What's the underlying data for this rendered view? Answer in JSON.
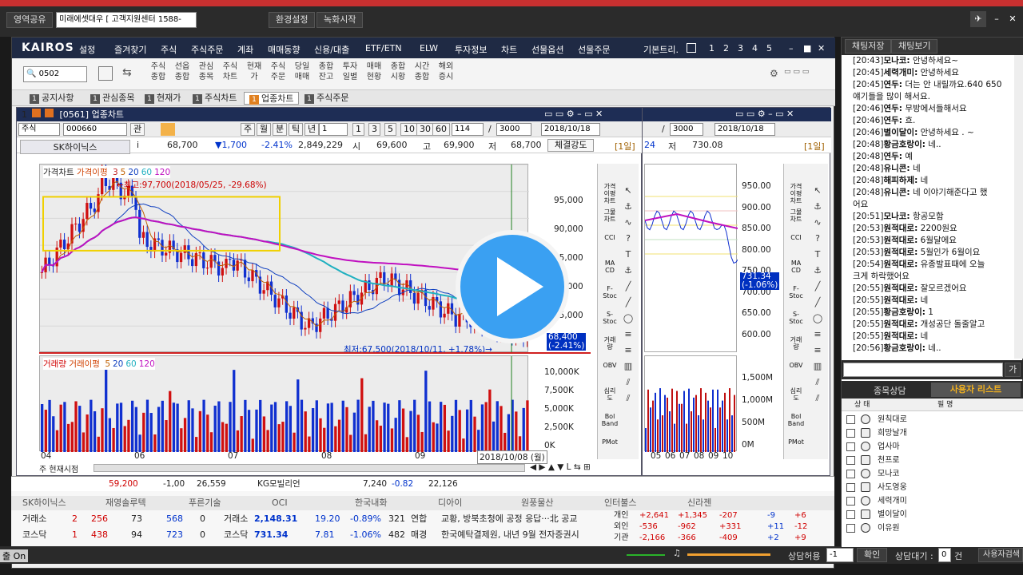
{
  "topbar": {
    "btn_left": "영역공유",
    "account_select": "미래에셋대우 [ 고객지원센터 1588-",
    "btn_settings": "환경설정",
    "btn_record": "녹화시작"
  },
  "menubar": {
    "logo": "KAIROS",
    "items": [
      "설정",
      "즐겨찾기",
      "주식",
      "주식주문",
      "계좌",
      "매매동향",
      "신용/대출",
      "ETF/ETN",
      "ELW",
      "투자정보",
      "차트",
      "선물옵션",
      "선물주문"
    ],
    "right_label": "기본트리.",
    "pages": [
      "1",
      "2",
      "3",
      "4",
      "5"
    ]
  },
  "toolbar": {
    "code_input": "0502",
    "buttons": [
      "주식 종합",
      "선옵 종합",
      "관심 종목",
      "주식 차트",
      "현재 가",
      "주식 주문",
      "당일 매매",
      "종합 잔고",
      "투자 일별",
      "매매 현황",
      "종합 시황",
      "시간 종합",
      "해외 증시"
    ]
  },
  "tabs": [
    {
      "num": "1",
      "label": "공지사항"
    },
    {
      "num": "1",
      "label": "관심종목"
    },
    {
      "num": "1",
      "label": "현재가"
    },
    {
      "num": "1",
      "label": "주식차트"
    },
    {
      "num": "1",
      "label": "업종차트"
    },
    {
      "num": "1",
      "label": "주식주문"
    }
  ],
  "win1": {
    "title": "[0561] 업종차트",
    "market": "주식",
    "code": "000660",
    "rel_btn": "관",
    "period_btns": [
      "주",
      "월",
      "분",
      "틱",
      "년"
    ],
    "interval_btns": [
      "1",
      "3",
      "5",
      "10",
      "30",
      "60"
    ],
    "count1": "114",
    "count2": "3000",
    "date": "2018/10/18",
    "name": "SK하이닉스",
    "price": "68,700",
    "change": "▼1,700",
    "change_pct": "-2.41%",
    "volume": "2,849,229",
    "open_lbl": "시",
    "open": "69,600",
    "high_lbl": "고",
    "high": "69,900",
    "low_lbl": "저",
    "low": "68,700",
    "strength_btn": "체결강도",
    "period_tag": "[1일]",
    "price_legend": "가격차트",
    "ma_legend": "가격이평",
    "ma_periods": [
      "3",
      "5",
      "20",
      "60",
      "120"
    ],
    "max_note": "←최고:97,700(2018/05/25, -29.68%)",
    "min_note": "최저:67,500(2018/10/11, +1.78%)→",
    "price_ticks": [
      "95,000",
      "90,000",
      "85,000",
      "80,000",
      "75,000",
      "70,000"
    ],
    "cur_price_tag": "68,400",
    "cur_pct_tag": "(-2.41%)",
    "vol_legend": "거래량",
    "vol_ma_legend": "거래이평",
    "vol_ma_periods": [
      "5",
      "20",
      "60",
      "120"
    ],
    "vol_ticks": [
      "10,000K",
      "7,500K",
      "5,000K",
      "2,500K",
      "0K"
    ],
    "x_ticks": [
      "04",
      "06",
      "07",
      "08",
      "09"
    ],
    "x_cursor": "2018/10/08 (월)",
    "bottom_left": "주 현재시점"
  },
  "win2": {
    "count": "3000",
    "date": "2018/10/18",
    "low_lbl": "저",
    "low": "730.08",
    "partial": "24",
    "period_tag": "[1일]",
    "price_ticks": [
      "950.00",
      "900.00",
      "850.00",
      "800.00",
      "750.00",
      "700.00",
      "650.00",
      "600.00"
    ],
    "cur_tag": "731.34",
    "cur_pct": "(-1.06%)",
    "vol_ticks": [
      "1,500M",
      "1,000M",
      "500M",
      "0M"
    ],
    "x_ticks": [
      "05",
      "06",
      "07",
      "08",
      "09",
      "10"
    ]
  },
  "indicators": [
    "가격 이평 차트",
    "그물 차트",
    "CCI",
    "MA CD",
    "F-Stoc",
    "S-Stoc",
    "거래 량",
    "OBV",
    "심리 도",
    "Bol Band",
    "PMot"
  ],
  "bottom": {
    "top_tickers": [
      "SK하이닉스",
      "재영솔루텍",
      "푸른기술",
      "OCI",
      "한국내화",
      "디아이",
      "원풍물산",
      "인터불스",
      "신라젠"
    ],
    "row1": {
      "market": "거래소",
      "v1": "2",
      "v2": "256",
      "v3": "73",
      "v4": "568",
      "v5": "0",
      "idx_name": "거래소",
      "idx": "2,148.31",
      "chg": "19.20",
      "pct": "-0.89%",
      "cnt": "321",
      "tag": "연합",
      "news": "교황, 방북초청에 공정 응답···北 공교"
    },
    "row2": {
      "market": "코스닥",
      "v1": "1",
      "v2": "438",
      "v3": "94",
      "v4": "723",
      "v5": "0",
      "idx_name": "코스닥",
      "idx": "731.34",
      "chg": "7.81",
      "pct": "-1.06%",
      "cnt": "482",
      "tag": "매경",
      "news": "한국예탁결제원, 내년 9월 전자증권시"
    },
    "investors": [
      {
        "name": "개인",
        "a": "+2,641",
        "b": "+1,345",
        "c": "-207",
        "d": "-9",
        "e": "+6"
      },
      {
        "name": "외인",
        "a": "-536",
        "b": "-962",
        "c": "+331",
        "d": "+11",
        "e": "-12"
      },
      {
        "name": "기관",
        "a": "-2,166",
        "b": "-366",
        "c": "-409",
        "d": "+2",
        "e": "+9"
      }
    ],
    "peek_row": {
      "n1": "59,200",
      "n2": "-1,00",
      "n3": "26,559",
      "name": "KG모빌리언",
      "n4": "7,240",
      "n5": "-0.82",
      "n6": "22,126"
    }
  },
  "status": {
    "left": "출 On",
    "accept_lbl": "상담허용",
    "accept_val": "-1",
    "confirm": "확인",
    "wait_lbl": "상담대기 :",
    "wait_val": "0",
    "wait_unit": "건",
    "right_btn": "사용자검색"
  },
  "chat": {
    "tab1": "채팅저장",
    "tab2": "채팅보기",
    "send_btn": "가",
    "lines": [
      {
        "t": "[20:43]",
        "n": "모나코:",
        "m": " 안녕하세요~"
      },
      {
        "t": "[20:45]",
        "n": "세력개미:",
        "m": " 안녕하세요"
      },
      {
        "t": "[20:45]",
        "n": "연두:",
        "m": " 더는 안 내릴까요.640 650"
      },
      {
        "t": "",
        "n": "",
        "m": "얘기들을 많이 해서요."
      },
      {
        "t": "[20:46]",
        "n": "연두:",
        "m": " 무방에서들해서요"
      },
      {
        "t": "[20:46]",
        "n": "연두:",
        "m": " 흐."
      },
      {
        "t": "[20:46]",
        "n": "별이달이:",
        "m": " 안녕하세요 . ~"
      },
      {
        "t": "[20:48]",
        "n": "황금호랑이:",
        "m": " 네.."
      },
      {
        "t": "[20:48]",
        "n": "연두:",
        "m": " 예"
      },
      {
        "t": "[20:48]",
        "n": "유니콘:",
        "m": " 네"
      },
      {
        "t": "[20:48]",
        "n": "해피하제:",
        "m": " 네"
      },
      {
        "t": "[20:48]",
        "n": "유니콘:",
        "m": " 네 이야기해준다고 했"
      },
      {
        "t": "",
        "n": "",
        "m": "어요"
      },
      {
        "t": "[20:51]",
        "n": "모나코:",
        "m": " 항공모함"
      },
      {
        "t": "[20:53]",
        "n": "원적대로:",
        "m": " 2200원요"
      },
      {
        "t": "[20:53]",
        "n": "원적대로:",
        "m": " 6월달에요"
      },
      {
        "t": "[20:53]",
        "n": "원적대로:",
        "m": " 5월인가 6월이요"
      },
      {
        "t": "[20:54]",
        "n": "원적대로:",
        "m": " 유종발표때에 오늘"
      },
      {
        "t": "",
        "n": "",
        "m": "크게 하락했어요"
      },
      {
        "t": "[20:55]",
        "n": "원적대로:",
        "m": " 잘모르겠어요"
      },
      {
        "t": "[20:55]",
        "n": "원적대로:",
        "m": " 네"
      },
      {
        "t": "[20:55]",
        "n": "황금호랑이:",
        "m": " 1"
      },
      {
        "t": "[20:55]",
        "n": "원적대로:",
        "m": " 개성공단 돌줄알고"
      },
      {
        "t": "[20:55]",
        "n": "원적대로:",
        "m": " 네"
      },
      {
        "t": "[20:56]",
        "n": "황금호랑이:",
        "m": " 네.."
      }
    ],
    "tab_stock": "종목상담",
    "tab_users": "사용자 리스트",
    "col_state": "상 태",
    "col_name": "필 명",
    "users": [
      "원칙대로",
      "희망날개",
      "업사마",
      "천프로",
      "모나코",
      "사도영웅",
      "세력개미",
      "별이달이",
      "이유원"
    ]
  },
  "chart_data": {
    "type": "candlestick",
    "x": [
      "04",
      "06",
      "07",
      "08",
      "09"
    ],
    "price_ylim": [
      65000,
      100000
    ],
    "price_max": 97700,
    "price_min": 67500,
    "last": 68700,
    "volume_ylim": [
      0,
      11000
    ],
    "volume_unit": "K"
  }
}
